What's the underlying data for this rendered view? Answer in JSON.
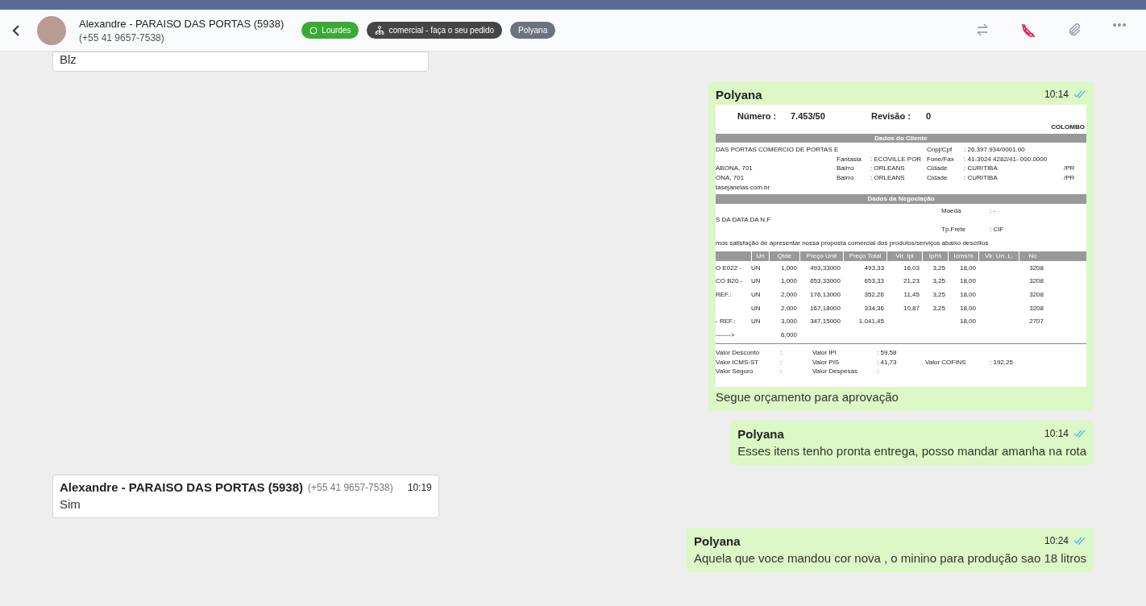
{
  "header": {
    "contact": "Alexandre - PARAISO DAS PORTAS (5938)",
    "phone": "(+55 41 9657-7538)",
    "tags": [
      {
        "label": "Lourdes",
        "color": "#3aaa35"
      },
      {
        "label": "comercial - faça o seu pedido",
        "color": "#454545"
      },
      {
        "label": "Polyana",
        "color": "#6b7280"
      }
    ]
  },
  "messages": [
    {
      "kind": "text",
      "sent": false,
      "text": "Blz"
    },
    {
      "kind": "document",
      "sent": true,
      "sender": "Polyana",
      "time": "10:14",
      "read": true,
      "caption": "Segue orçamento para aprovação",
      "document": {
        "number_label": "Número :",
        "number": "7.453/50",
        "revision_label": "Revisão :",
        "revision": "0",
        "city": "COLOMBO",
        "client_title": "Dados do Cliente",
        "client_rows": [
          [
            "DAS PORTAS COMERCIO DE PORTAS E",
            null,
            null,
            "Cnpj/Cpf",
            ": 26.397.934/0001.00",
            null
          ],
          [
            null,
            "Fantasia",
            ": ECOVILLE POR",
            "Fone/Fax",
            ": 41-3024 4282/41- 000.0000",
            null
          ],
          [
            "ABONA, 701",
            "Bairro",
            ": ORLEANS",
            "Cidade",
            ": CURITIBA",
            "/PR"
          ],
          [
            "ONA, 701",
            "Bairro",
            ": ORLEANS",
            "Cidade",
            ": CURITIBA",
            "/PR"
          ],
          [
            "tasejanelas.com.br",
            null,
            null,
            null,
            null,
            null
          ]
        ],
        "negotiation_title": "Dados da Negociação",
        "negotiation_rows": [
          [
            null,
            null,
            "Moeda",
            ": -"
          ],
          [
            "S DA DATA DA N.F",
            null,
            null,
            null
          ],
          [
            null,
            null,
            "Tp.Frete",
            ": CIF"
          ]
        ],
        "sentence": "mos satisfação de apresentar nossa proposta comercial dos produtos/serviços abaixo descritos",
        "columns": [
          null,
          "Un",
          "Qtde",
          "Preço Unit",
          "Preço Total",
          "Vlr. Ipi",
          "Ipi%",
          "Icms%",
          "Vlr. Un. L.",
          "Nc"
        ],
        "rows": [
          [
            "O E022 -",
            "UN",
            "1,000",
            "493,33000",
            "493,33",
            "16,03",
            "3,25",
            "18,00",
            null,
            "3208"
          ],
          [
            "CO B20 -",
            "UN",
            "1,000",
            "653,33000",
            "653,33",
            "21,23",
            "3,25",
            "18,00",
            null,
            "3208"
          ],
          [
            "REF.:",
            "UN",
            "2,000",
            "176,13000",
            "352,26",
            "11,45",
            "3,25",
            "18,00",
            null,
            "3208"
          ],
          [
            null,
            "UN",
            "2,000",
            "167,18000",
            "334,36",
            "10,87",
            "3,25",
            "18,00",
            null,
            "3208"
          ],
          [
            "- REF.:",
            "UN",
            "3,000",
            "347,15000",
            "1.041,45",
            null,
            null,
            "18,00",
            null,
            "2707"
          ],
          [
            "------->",
            null,
            "6,000",
            null,
            null,
            null,
            null,
            null,
            null,
            null
          ]
        ],
        "totals": [
          [
            "Valor Desconto",
            ":",
            "Valor IPI",
            ": 59,58"
          ],
          [
            "Valor ICMS-ST",
            ":",
            "Valor PIS",
            ": 41,73",
            "Valor COFINS",
            ": 192,25"
          ],
          [
            "Valor Seguro",
            ":",
            "Valor Despesas",
            ":"
          ]
        ]
      }
    },
    {
      "kind": "text",
      "sent": true,
      "sender": "Polyana",
      "time": "10:14",
      "read": true,
      "text": "Esses itens tenho pronta entrega, posso mandar amanha na rota"
    },
    {
      "kind": "text",
      "sent": false,
      "sender": "Alexandre - PARAISO DAS PORTAS (5938)",
      "phone": "(+55 41 9657-7538)",
      "time": "10:19",
      "text": "Sim"
    },
    {
      "kind": "text",
      "sent": true,
      "sender": "Polyana",
      "time": "10:24",
      "read": true,
      "text": "Aquela que voce mandou cor nova , o minino para produção sao 18 litros"
    }
  ]
}
